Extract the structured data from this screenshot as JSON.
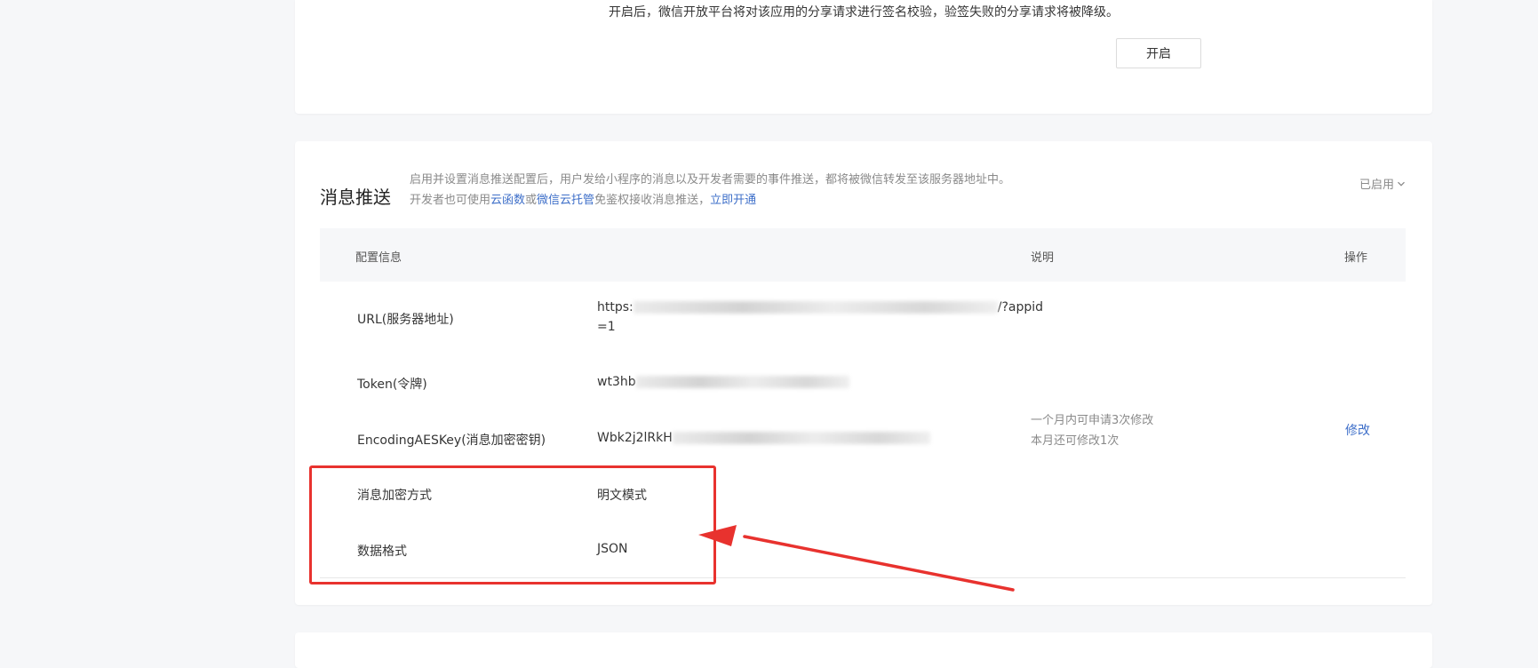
{
  "signature": {
    "description": "开启后，微信开放平台将对该应用的分享请求进行签名校验，验签失败的分享请求将被降级。",
    "button_label": "开启"
  },
  "message_push": {
    "title": "消息推送",
    "desc_line1": "启用并设置消息推送配置后，用户发给小程序的消息以及开发者需要的事件推送，都将被微信转发至该服务器地址中。",
    "desc_line2_prefix": "开发者也可使用",
    "desc_link_cloud_function": "云函数",
    "desc_or": "或",
    "desc_link_cloud_hosting": "微信云托管",
    "desc_line2_suffix": "免鉴权接收消息推送，",
    "desc_link_enable": "立即开通",
    "status_label": "已启用",
    "table": {
      "headers": {
        "config": "配置信息",
        "explain": "说明",
        "action": "操作"
      },
      "rows": [
        {
          "label": "URL(服务器地址)",
          "value_start": "https:",
          "value_tail": "/?appid",
          "value_line2": "=1"
        },
        {
          "label": "Token(令牌)",
          "value_start": "wt3hb",
          "value_tail": ""
        },
        {
          "label": "EncodingAESKey(消息加密密钥)",
          "value_start": "Wbk2j2lRkH",
          "value_tail": ""
        },
        {
          "label": "消息加密方式",
          "value_start": "明文模式"
        },
        {
          "label": "数据格式",
          "value_start": "JSON"
        }
      ],
      "note_line1": "一个月内可申请3次修改",
      "note_line2": "本月还可修改1次",
      "action_label": "修改"
    }
  },
  "colors": {
    "accent_link": "#3e6fc9",
    "annotation_red": "#e8322e",
    "background": "#f6f7f9"
  },
  "icons": {
    "status_dropdown": "chevron-down-icon"
  }
}
